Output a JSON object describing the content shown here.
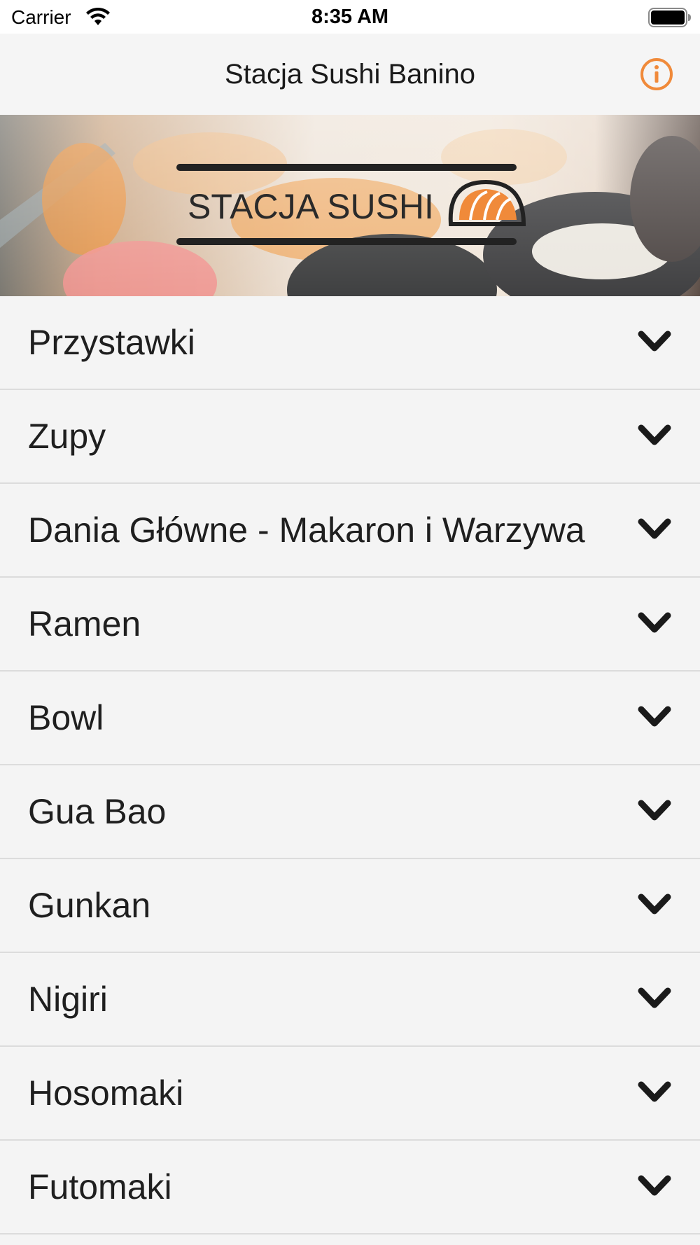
{
  "status_bar": {
    "carrier": "Carrier",
    "time": "8:35 AM"
  },
  "nav": {
    "title": "Stacja Sushi Banino",
    "info_icon": "info-circle-icon",
    "accent_color": "#f08a3a"
  },
  "banner": {
    "logo_text": "STACJA SUSHI"
  },
  "categories": [
    {
      "label": "Przystawki"
    },
    {
      "label": "Zupy"
    },
    {
      "label": "Dania Główne - Makaron i Warzywa"
    },
    {
      "label": "Ramen"
    },
    {
      "label": "Bowl"
    },
    {
      "label": "Gua Bao"
    },
    {
      "label": "Gunkan"
    },
    {
      "label": "Nigiri"
    },
    {
      "label": "Hosomaki"
    },
    {
      "label": "Futomaki"
    }
  ],
  "row_icon": "chevron-down-icon"
}
